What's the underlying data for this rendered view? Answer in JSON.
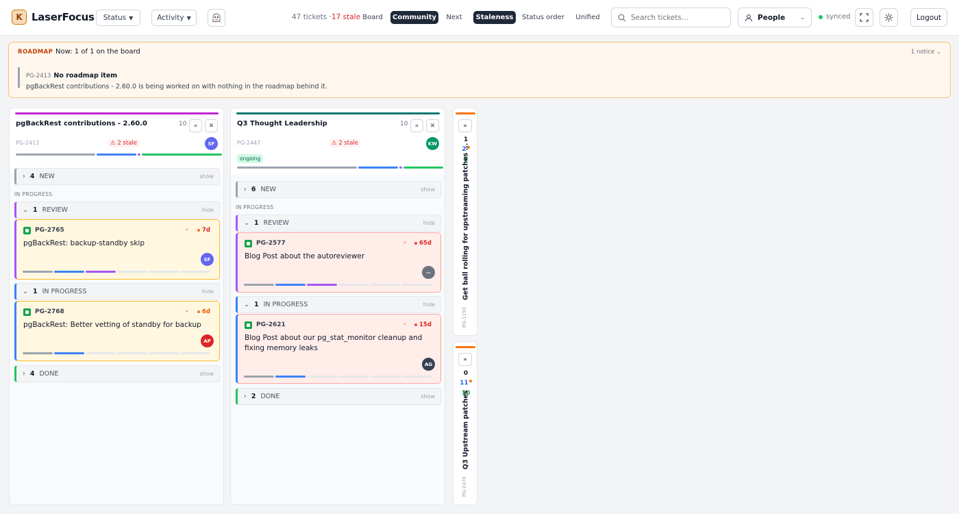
{
  "header": {
    "logo_mark": "K",
    "app_name": "LaserFocus",
    "status_label": "Status",
    "activity_label": "Activity",
    "ticket_count": "47 tickets",
    "stale_count": "17 stale",
    "views": [
      "Board",
      "Community",
      "Next"
    ],
    "active_view": "Community",
    "sorts": [
      "Staleness",
      "Status order",
      "Unified"
    ],
    "active_sort": "Staleness",
    "search_placeholder": "Search tickets...",
    "people_label": "People",
    "sync_status": "synced",
    "logout_label": "Logout"
  },
  "roadmap": {
    "label": "ROADMAP",
    "now": "Now: 1 of 1 on the board",
    "notice": "1 notice",
    "item": {
      "id": "PG-2413",
      "title": "No roadmap item",
      "description": "pgBackRest contributions - 2.60.0 is being worked on with nothing in the roadmap behind it."
    }
  },
  "columns": [
    {
      "title": "pgBackRest contributions - 2.60.0",
      "count": "10",
      "id": "PG-2413",
      "stale": "⚠ 2 stale",
      "avatar": "SF",
      "avatar_color": "#6366f1",
      "accent": "#c026d3",
      "groups": {
        "new": {
          "count": "4",
          "label": "NEW",
          "toggle": "show"
        },
        "section": "IN PROGRESS",
        "review": {
          "count": "1",
          "label": "REVIEW",
          "toggle": "hide"
        },
        "inprogress": {
          "count": "1",
          "label": "IN PROGRESS",
          "toggle": "hide"
        },
        "done": {
          "count": "4",
          "label": "DONE",
          "toggle": "show"
        }
      },
      "cards": [
        {
          "id": "PG-2765",
          "title": "pgBackRest: backup-standby skip",
          "age": "7d",
          "avatar": "SF",
          "avatar_color": "#6366f1"
        },
        {
          "id": "PG-2768",
          "title": "pgBackRest: Better vetting of standby for backup",
          "age": "6d",
          "avatar": "AP",
          "avatar_color": "#dc2626"
        }
      ]
    },
    {
      "title": "Q3 Thought Leadership",
      "count": "10",
      "id": "PG-2447",
      "stale": "⚠ 2 stale",
      "tag": "ongoing",
      "avatar": "KW",
      "avatar_color": "#059669",
      "accent": "#0f766e",
      "groups": {
        "new": {
          "count": "6",
          "label": "NEW",
          "toggle": "show"
        },
        "section": "IN PROGRESS",
        "review": {
          "count": "1",
          "label": "REVIEW",
          "toggle": "hide"
        },
        "inprogress": {
          "count": "1",
          "label": "IN PROGRESS",
          "toggle": "hide"
        },
        "done": {
          "count": "2",
          "label": "DONE",
          "toggle": "show"
        }
      },
      "cards": [
        {
          "id": "PG-2577",
          "title": "Blog Post about the autoreviewer",
          "age": "65d",
          "avatar": "—",
          "avatar_color": "#6b7280"
        },
        {
          "id": "PG-2621",
          "title": "Blog Post about our pg_stat_monitor cleanup and fixing memory leaks",
          "age": "15d",
          "avatar": "AG",
          "avatar_color": "#374151"
        }
      ]
    }
  ],
  "collapsed": [
    {
      "title": "Get ball rolling for upstreaming patches ...",
      "id": "PG-1193",
      "counts": [
        "1",
        "2",
        "3"
      ]
    },
    {
      "title": "Q3 Upstream patches",
      "id": "PG-2476",
      "counts": [
        "0",
        "11",
        "10"
      ]
    }
  ]
}
